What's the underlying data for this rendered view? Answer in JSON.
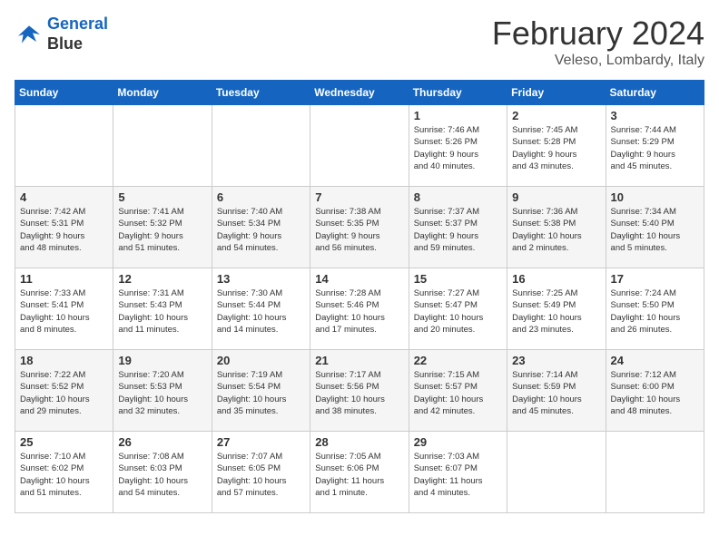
{
  "header": {
    "logo_line1": "General",
    "logo_line2": "Blue",
    "month": "February 2024",
    "location": "Veleso, Lombardy, Italy"
  },
  "weekdays": [
    "Sunday",
    "Monday",
    "Tuesday",
    "Wednesday",
    "Thursday",
    "Friday",
    "Saturday"
  ],
  "weeks": [
    [
      {
        "day": "",
        "info": ""
      },
      {
        "day": "",
        "info": ""
      },
      {
        "day": "",
        "info": ""
      },
      {
        "day": "",
        "info": ""
      },
      {
        "day": "1",
        "info": "Sunrise: 7:46 AM\nSunset: 5:26 PM\nDaylight: 9 hours\nand 40 minutes."
      },
      {
        "day": "2",
        "info": "Sunrise: 7:45 AM\nSunset: 5:28 PM\nDaylight: 9 hours\nand 43 minutes."
      },
      {
        "day": "3",
        "info": "Sunrise: 7:44 AM\nSunset: 5:29 PM\nDaylight: 9 hours\nand 45 minutes."
      }
    ],
    [
      {
        "day": "4",
        "info": "Sunrise: 7:42 AM\nSunset: 5:31 PM\nDaylight: 9 hours\nand 48 minutes."
      },
      {
        "day": "5",
        "info": "Sunrise: 7:41 AM\nSunset: 5:32 PM\nDaylight: 9 hours\nand 51 minutes."
      },
      {
        "day": "6",
        "info": "Sunrise: 7:40 AM\nSunset: 5:34 PM\nDaylight: 9 hours\nand 54 minutes."
      },
      {
        "day": "7",
        "info": "Sunrise: 7:38 AM\nSunset: 5:35 PM\nDaylight: 9 hours\nand 56 minutes."
      },
      {
        "day": "8",
        "info": "Sunrise: 7:37 AM\nSunset: 5:37 PM\nDaylight: 9 hours\nand 59 minutes."
      },
      {
        "day": "9",
        "info": "Sunrise: 7:36 AM\nSunset: 5:38 PM\nDaylight: 10 hours\nand 2 minutes."
      },
      {
        "day": "10",
        "info": "Sunrise: 7:34 AM\nSunset: 5:40 PM\nDaylight: 10 hours\nand 5 minutes."
      }
    ],
    [
      {
        "day": "11",
        "info": "Sunrise: 7:33 AM\nSunset: 5:41 PM\nDaylight: 10 hours\nand 8 minutes."
      },
      {
        "day": "12",
        "info": "Sunrise: 7:31 AM\nSunset: 5:43 PM\nDaylight: 10 hours\nand 11 minutes."
      },
      {
        "day": "13",
        "info": "Sunrise: 7:30 AM\nSunset: 5:44 PM\nDaylight: 10 hours\nand 14 minutes."
      },
      {
        "day": "14",
        "info": "Sunrise: 7:28 AM\nSunset: 5:46 PM\nDaylight: 10 hours\nand 17 minutes."
      },
      {
        "day": "15",
        "info": "Sunrise: 7:27 AM\nSunset: 5:47 PM\nDaylight: 10 hours\nand 20 minutes."
      },
      {
        "day": "16",
        "info": "Sunrise: 7:25 AM\nSunset: 5:49 PM\nDaylight: 10 hours\nand 23 minutes."
      },
      {
        "day": "17",
        "info": "Sunrise: 7:24 AM\nSunset: 5:50 PM\nDaylight: 10 hours\nand 26 minutes."
      }
    ],
    [
      {
        "day": "18",
        "info": "Sunrise: 7:22 AM\nSunset: 5:52 PM\nDaylight: 10 hours\nand 29 minutes."
      },
      {
        "day": "19",
        "info": "Sunrise: 7:20 AM\nSunset: 5:53 PM\nDaylight: 10 hours\nand 32 minutes."
      },
      {
        "day": "20",
        "info": "Sunrise: 7:19 AM\nSunset: 5:54 PM\nDaylight: 10 hours\nand 35 minutes."
      },
      {
        "day": "21",
        "info": "Sunrise: 7:17 AM\nSunset: 5:56 PM\nDaylight: 10 hours\nand 38 minutes."
      },
      {
        "day": "22",
        "info": "Sunrise: 7:15 AM\nSunset: 5:57 PM\nDaylight: 10 hours\nand 42 minutes."
      },
      {
        "day": "23",
        "info": "Sunrise: 7:14 AM\nSunset: 5:59 PM\nDaylight: 10 hours\nand 45 minutes."
      },
      {
        "day": "24",
        "info": "Sunrise: 7:12 AM\nSunset: 6:00 PM\nDaylight: 10 hours\nand 48 minutes."
      }
    ],
    [
      {
        "day": "25",
        "info": "Sunrise: 7:10 AM\nSunset: 6:02 PM\nDaylight: 10 hours\nand 51 minutes."
      },
      {
        "day": "26",
        "info": "Sunrise: 7:08 AM\nSunset: 6:03 PM\nDaylight: 10 hours\nand 54 minutes."
      },
      {
        "day": "27",
        "info": "Sunrise: 7:07 AM\nSunset: 6:05 PM\nDaylight: 10 hours\nand 57 minutes."
      },
      {
        "day": "28",
        "info": "Sunrise: 7:05 AM\nSunset: 6:06 PM\nDaylight: 11 hours\nand 1 minute."
      },
      {
        "day": "29",
        "info": "Sunrise: 7:03 AM\nSunset: 6:07 PM\nDaylight: 11 hours\nand 4 minutes."
      },
      {
        "day": "",
        "info": ""
      },
      {
        "day": "",
        "info": ""
      }
    ]
  ]
}
